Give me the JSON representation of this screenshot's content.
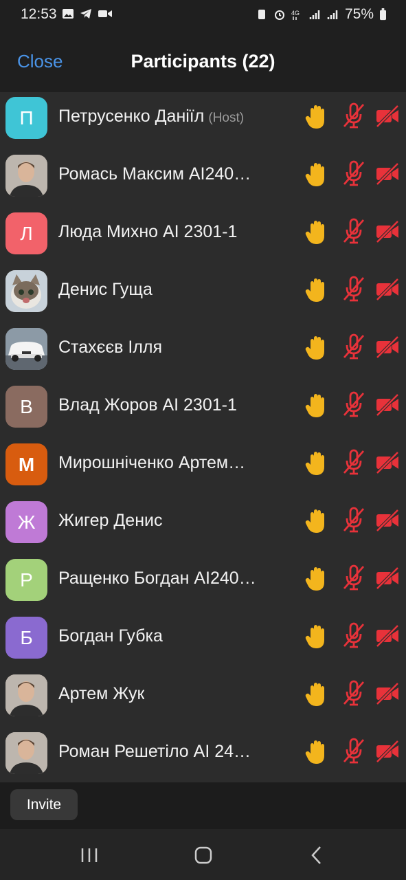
{
  "status_bar": {
    "time": "12:53",
    "battery": "75%"
  },
  "header": {
    "close_label": "Close",
    "title": "Participants (22)"
  },
  "participants": [
    {
      "name": "Петрусенко Даніїл",
      "role": "(Host)",
      "avatar_letter": "П",
      "avatar_color": "#3fc5d6"
    },
    {
      "name": "Ромась Максим AI240…",
      "role": "",
      "avatar_letter": "",
      "avatar_color": "#7a6a5d",
      "avatar_photo": "person"
    },
    {
      "name": "Люда Михно AI 2301-1",
      "role": "",
      "avatar_letter": "Л",
      "avatar_color": "#f2626a"
    },
    {
      "name": "Денис Гуща",
      "role": "",
      "avatar_letter": "",
      "avatar_color": "#9a8a7a",
      "avatar_photo": "cat"
    },
    {
      "name": "Стахєєв Ілля",
      "role": "",
      "avatar_letter": "",
      "avatar_color": "#7f8a96",
      "avatar_photo": "car"
    },
    {
      "name": "Влад Жоров AI 2301-1",
      "role": "",
      "avatar_letter": "В",
      "avatar_color": "#8a6b60"
    },
    {
      "name": "Мирошніченко Артем…",
      "role": "",
      "avatar_letter": "М",
      "avatar_color": "#d85c0f"
    },
    {
      "name": "Жигер Денис",
      "role": "",
      "avatar_letter": "Ж",
      "avatar_color": "#bf7ad6"
    },
    {
      "name": "Ращенко Богдан AI240…",
      "role": "",
      "avatar_letter": "Р",
      "avatar_color": "#a3d17a"
    },
    {
      "name": "Богдан Губка",
      "role": "",
      "avatar_letter": "Б",
      "avatar_color": "#8a6ad0"
    },
    {
      "name": "Артем Жук",
      "role": "",
      "avatar_letter": "",
      "avatar_color": "#c9b3a3",
      "avatar_photo": "person"
    },
    {
      "name": "Роман Решетіло AI 24…",
      "role": "",
      "avatar_letter": "",
      "avatar_color": "#b9b4ad",
      "avatar_photo": "person"
    }
  ],
  "row_icons": {
    "hand": "raised-hand-icon",
    "mic": "mic-muted-icon",
    "camera": "camera-off-icon"
  },
  "colors": {
    "hand": "#f3b51d",
    "muted": "#e8323a",
    "link": "#4a94e8"
  },
  "footer": {
    "invite_label": "Invite"
  }
}
